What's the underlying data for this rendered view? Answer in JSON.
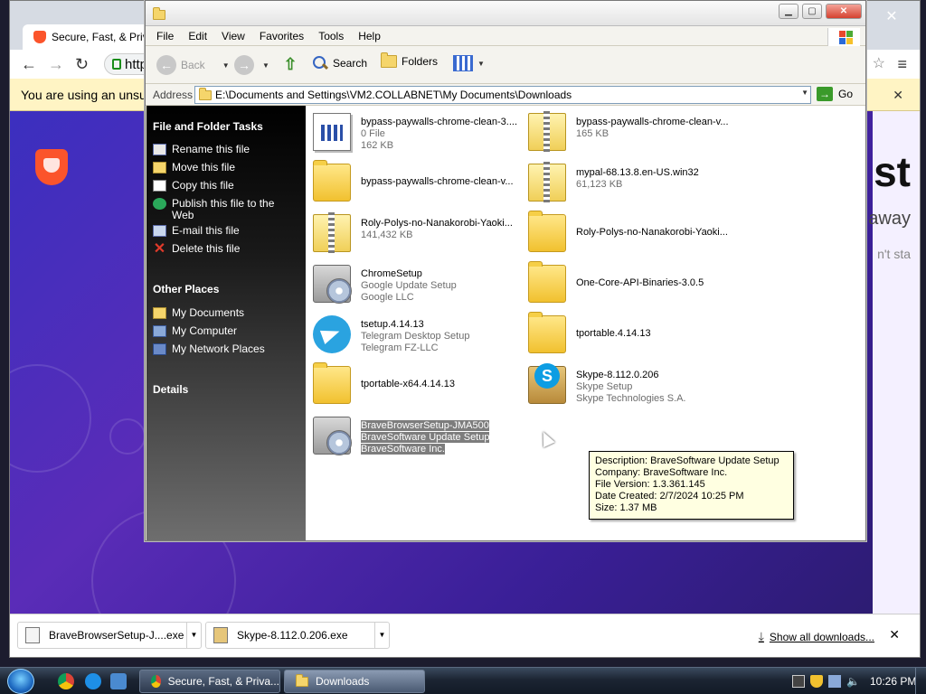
{
  "browser": {
    "tab_title": "Secure, Fast, & Priva",
    "url_partial": "http",
    "infobar_text": "You are using an unsu",
    "page_headline": "st",
    "page_subline": "away",
    "page_small": "n't sta",
    "downloads": [
      {
        "name": "BraveBrowserSetup-J....exe"
      },
      {
        "name": "Skype-8.112.0.206.exe"
      }
    ],
    "show_all_label": "Show all downloads..."
  },
  "explorer": {
    "menu": [
      "File",
      "Edit",
      "View",
      "Favorites",
      "Tools",
      "Help"
    ],
    "toolbar": {
      "back": "Back",
      "search": "Search",
      "folders": "Folders"
    },
    "address": {
      "label": "Address",
      "value": "E:\\Documents and Settings\\VM2.COLLABNET\\My Documents\\Downloads",
      "go": "Go"
    },
    "tasks": {
      "file_tasks_title": "File and Folder Tasks",
      "file_tasks": [
        {
          "label": "Rename this file"
        },
        {
          "label": "Move this file"
        },
        {
          "label": "Copy this file"
        },
        {
          "label": "Publish this file to the Web"
        },
        {
          "label": "E-mail this file"
        },
        {
          "label": "Delete this file"
        }
      ],
      "other_places_title": "Other Places",
      "other_places": [
        {
          "label": "My Documents"
        },
        {
          "label": "My Computer"
        },
        {
          "label": "My Network Places"
        }
      ],
      "details_title": "Details"
    },
    "files": [
      {
        "icon": "doc-icon",
        "l1": "bypass-paywalls-chrome-clean-3....",
        "l2": "0 File",
        "l3": "162 KB"
      },
      {
        "icon": "zip-icon",
        "l1": "bypass-paywalls-chrome-clean-v...",
        "l2": "165 KB",
        "l3": ""
      },
      {
        "icon": "folder-icon",
        "l1": "bypass-paywalls-chrome-clean-v...",
        "l2": "",
        "l3": ""
      },
      {
        "icon": "zip-icon",
        "l1": "mypal-68.13.8.en-US.win32",
        "l2": "61,123 KB",
        "l3": ""
      },
      {
        "icon": "zip-icon",
        "l1": "Roly-Polys-no-Nanakorobi-Yaoki...",
        "l2": "141,432 KB",
        "l3": ""
      },
      {
        "icon": "folder-icon",
        "l1": "Roly-Polys-no-Nanakorobi-Yaoki...",
        "l2": "",
        "l3": ""
      },
      {
        "icon": "setup-icon",
        "l1": "ChromeSetup",
        "l2": "Google Update Setup",
        "l3": "Google LLC"
      },
      {
        "icon": "folder-icon",
        "l1": "One-Core-API-Binaries-3.0.5",
        "l2": "",
        "l3": ""
      },
      {
        "icon": "telegram-icon",
        "l1": "tsetup.4.14.13",
        "l2": "Telegram Desktop Setup",
        "l3": "Telegram FZ-LLC"
      },
      {
        "icon": "folder-icon",
        "l1": "tportable.4.14.13",
        "l2": "",
        "l3": ""
      },
      {
        "icon": "folder-icon",
        "l1": "tportable-x64.4.14.13",
        "l2": "",
        "l3": ""
      },
      {
        "icon": "skype-icon",
        "l1": "Skype-8.112.0.206",
        "l2": "Skype Setup",
        "l3": "Skype Technologies S.A."
      },
      {
        "icon": "setup-icon",
        "l1": "BraveBrowserSetup-JMA500",
        "l2": "BraveSoftware Update Setup",
        "l3": "BraveSoftware Inc.",
        "selected": true
      }
    ],
    "tooltip": [
      "Description: BraveSoftware Update Setup",
      "Company: BraveSoftware Inc.",
      "File Version: 1.3.361.145",
      "Date Created: 2/7/2024 10:25 PM",
      "Size: 1.37 MB"
    ]
  },
  "taskbar": {
    "buttons": [
      {
        "label": "Secure, Fast, & Priva..."
      },
      {
        "label": "Downloads"
      }
    ],
    "clock": "10:26 PM"
  }
}
